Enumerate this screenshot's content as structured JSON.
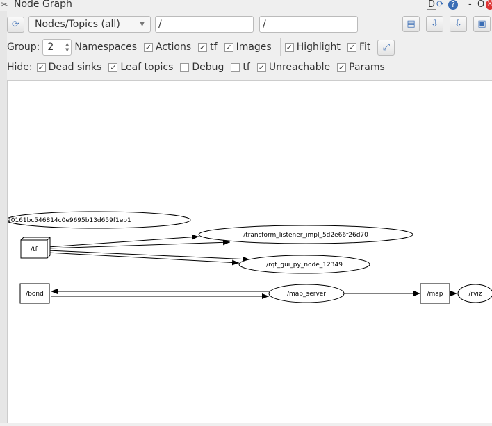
{
  "window": {
    "title": "Node Graph",
    "controls": [
      "D",
      "-",
      "O"
    ]
  },
  "toolbar": {
    "view_mode": "Nodes/Topics (all)",
    "filter_1": "/",
    "filter_2": "/"
  },
  "options": {
    "group_label": "Group:",
    "group_value": "2",
    "items": [
      {
        "label": "Namespaces",
        "checked": null
      },
      {
        "label": "Actions",
        "checked": true
      },
      {
        "label": "tf",
        "checked": true
      },
      {
        "label": "Images",
        "checked": true
      }
    ],
    "items2": [
      {
        "label": "Highlight",
        "checked": true
      },
      {
        "label": "Fit",
        "checked": true
      }
    ]
  },
  "hide": {
    "label": "Hide:",
    "items": [
      {
        "label": "Dead sinks",
        "checked": true
      },
      {
        "label": "Leaf topics",
        "checked": true
      },
      {
        "label": "Debug",
        "checked": false
      },
      {
        "label": "tf",
        "checked": false
      },
      {
        "label": "Unreachable",
        "checked": true
      },
      {
        "label": "Params",
        "checked": true
      }
    ]
  },
  "graph": {
    "nodes": [
      {
        "id": "n0",
        "label": "90161bc546814c0e9695b13d659f1eb1",
        "shape": "ellipse"
      },
      {
        "id": "tl",
        "label": "/transform_listener_impl_5d2e66f26d70",
        "shape": "ellipse"
      },
      {
        "id": "tf",
        "label": "/tf",
        "shape": "box3d"
      },
      {
        "id": "rqt",
        "label": "/rqt_gui_py_node_12349",
        "shape": "ellipse"
      },
      {
        "id": "bond",
        "label": "/bond",
        "shape": "box"
      },
      {
        "id": "ms",
        "label": "/map_server",
        "shape": "ellipse"
      },
      {
        "id": "map",
        "label": "/map",
        "shape": "box"
      },
      {
        "id": "rviz",
        "label": "/rviz",
        "shape": "ellipse"
      }
    ],
    "edges": [
      [
        "tf",
        "tl"
      ],
      [
        "tf",
        "tl"
      ],
      [
        "tf",
        "rqt"
      ],
      [
        "tf",
        "rqt"
      ],
      [
        "ms",
        "bond"
      ],
      [
        "bond",
        "ms"
      ],
      [
        "ms",
        "map"
      ],
      [
        "map",
        "rviz"
      ]
    ]
  }
}
